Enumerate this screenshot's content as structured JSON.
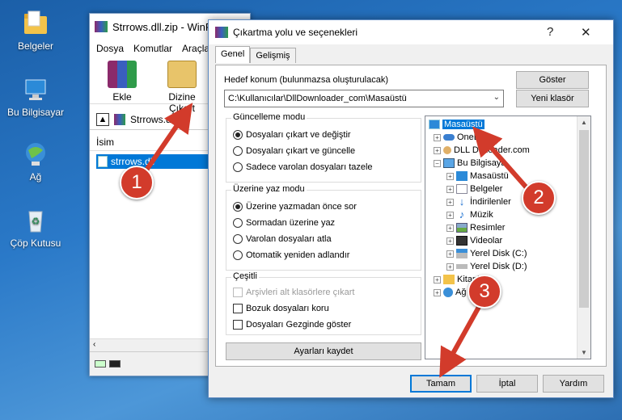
{
  "desktop": {
    "icons": [
      {
        "label": "Belgeler"
      },
      {
        "label": "Bu Bilgisayar"
      },
      {
        "label": "Ağ"
      },
      {
        "label": "Çöp Kutusu"
      }
    ]
  },
  "winrar": {
    "title": "Strrows.dll.zip - WinR",
    "menu": [
      "Dosya",
      "Komutlar",
      "Araçla"
    ],
    "toolbar": {
      "add_label": "Ekle",
      "extract_label": "Dizine Çıkart"
    },
    "path": "Strrows.dll.z",
    "column_name": "İsim",
    "file_name": "strrows.dll"
  },
  "dialog": {
    "title": "Çıkartma yolu ve seçenekleri",
    "help_glyph": "?",
    "close_glyph": "✕",
    "tabs": [
      "Genel",
      "Gelişmiş"
    ],
    "destination_label": "Hedef konum (bulunmazsa oluşturulacak)",
    "destination_value": "C:\\Kullanıcılar\\DllDownloader_com\\Masaüstü",
    "show_button": "Göster",
    "new_folder_button": "Yeni klasör",
    "update_mode": {
      "title": "Güncelleme modu",
      "options": [
        "Dosyaları çıkart ve değiştir",
        "Dosyaları çıkart ve güncelle",
        "Sadece varolan dosyaları tazele"
      ],
      "selected": 0
    },
    "overwrite_mode": {
      "title": "Üzerine yaz modu",
      "options": [
        "Üzerine yazmadan önce sor",
        "Sormadan üzerine yaz",
        "Varolan dosyaları atla",
        "Otomatik yeniden adlandır"
      ],
      "selected": 0
    },
    "misc": {
      "title": "Çeşitli",
      "options": [
        "Arşivleri alt klasörlere çıkart",
        "Bozuk dosyaları koru",
        "Dosyaları Gezginde göster"
      ],
      "disabled": [
        true,
        false,
        false
      ]
    },
    "save_settings_button": "Ayarları kaydet",
    "tree": [
      {
        "label": "Masaüstü",
        "level": 0,
        "icon": "desktop-icon",
        "selected": true
      },
      {
        "label": "OneD",
        "level": 1,
        "icon": "cloud-icon"
      },
      {
        "label": "DLL Do   loader.com",
        "level": 1,
        "icon": "user-icon"
      },
      {
        "label": "Bu Bilgisaya",
        "level": 1,
        "icon": "computer-icon",
        "expanded": true
      },
      {
        "label": "Masaüstü",
        "level": 2,
        "icon": "desktop-icon"
      },
      {
        "label": "Belgeler",
        "level": 2,
        "icon": "documents-icon"
      },
      {
        "label": "İndirilenler",
        "level": 2,
        "icon": "download-icon"
      },
      {
        "label": "Müzik",
        "level": 2,
        "icon": "music-icon"
      },
      {
        "label": "Resimler",
        "level": 2,
        "icon": "pictures-icon"
      },
      {
        "label": "Videolar",
        "level": 2,
        "icon": "video-icon"
      },
      {
        "label": "Yerel Disk (C:)",
        "level": 2,
        "icon": "drive-icon"
      },
      {
        "label": "Yerel Disk (D:)",
        "level": 2,
        "icon": "drive-icon"
      },
      {
        "label": "Kitapl",
        "level": 1,
        "icon": "library-icon"
      },
      {
        "label": "Ağ",
        "level": 1,
        "icon": "network-icon"
      }
    ],
    "ok_button": "Tamam",
    "cancel_button": "İptal",
    "help_button": "Yardım"
  },
  "annotations": [
    "1",
    "2",
    "3"
  ],
  "colors": {
    "selection": "#0078d7",
    "badge": "#d23b2b"
  }
}
